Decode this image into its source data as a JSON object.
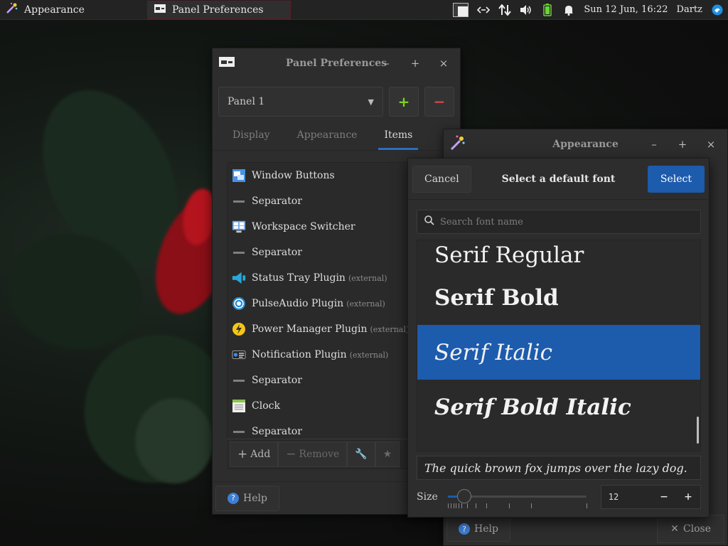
{
  "top_panel": {
    "tasks": [
      {
        "label": "Appearance",
        "icon": "appearance-wand-icon"
      },
      {
        "label": "Panel Preferences",
        "icon": "panel-prefs-icon"
      }
    ],
    "clock": "Sun 12 Jun, 16:22",
    "user": "Dartz",
    "tray_icons": [
      "workspace-switcher-icon",
      "network-icon",
      "transfer-arrows-icon",
      "volume-icon",
      "battery-icon",
      "notification-bell-icon",
      "user-menu-icon"
    ]
  },
  "panel_preferences": {
    "title": "Panel Preferences",
    "panel_select": "Panel 1",
    "tabs": [
      "Display",
      "Appearance",
      "Items"
    ],
    "active_tab": "Items",
    "items": [
      {
        "label": "Window Buttons",
        "ext": "",
        "icon": "window-buttons-icon"
      },
      {
        "label": "Separator",
        "ext": "",
        "icon": "separator-icon"
      },
      {
        "label": "Workspace Switcher",
        "ext": "",
        "icon": "workspace-switcher-icon"
      },
      {
        "label": "Separator",
        "ext": "",
        "icon": "separator-icon"
      },
      {
        "label": "Status Tray Plugin",
        "ext": "(external)",
        "icon": "status-tray-icon"
      },
      {
        "label": "PulseAudio Plugin",
        "ext": "(external)",
        "icon": "pulseaudio-icon"
      },
      {
        "label": "Power Manager Plugin",
        "ext": "(external)",
        "icon": "power-manager-icon"
      },
      {
        "label": "Notification Plugin",
        "ext": "(external)",
        "icon": "notification-plugin-icon"
      },
      {
        "label": "Separator",
        "ext": "",
        "icon": "separator-icon"
      },
      {
        "label": "Clock",
        "ext": "",
        "icon": "clock-icon"
      },
      {
        "label": "Separator",
        "ext": "",
        "icon": "separator-icon"
      }
    ],
    "toolbar": {
      "add": "Add",
      "remove": "Remove"
    },
    "help": "Help"
  },
  "appearance": {
    "title": "Appearance",
    "help": "Help",
    "close": "Close"
  },
  "font_chooser": {
    "title": "Select a default font",
    "cancel": "Cancel",
    "select": "Select",
    "search_placeholder": "Search font name",
    "fonts": [
      "Serif Regular",
      "Serif Bold",
      "Serif Italic",
      "Serif Bold Italic"
    ],
    "selected_font": "Serif Italic",
    "preview": "The quick brown fox jumps over the lazy dog.",
    "size_label": "Size",
    "size_value": "12",
    "size_fraction": 0.08
  },
  "colors": {
    "accent": "#1d5bad",
    "add_green": "#7ed321",
    "remove_red": "#e04545"
  }
}
